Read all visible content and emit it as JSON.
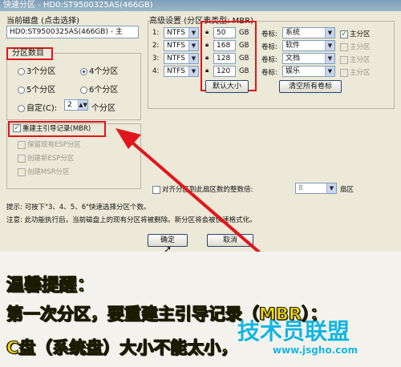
{
  "window": {
    "title": "快速分区 - HD0:ST9500325AS(466GB)"
  },
  "disk": {
    "label": "当前磁盘 (点击选择)",
    "value": "HD0:ST9500325AS(466GB) - 主"
  },
  "partition_count": {
    "title": "分区数目",
    "options": [
      "3个分区",
      "4个分区",
      "5个分区",
      "6个分区"
    ],
    "selected": "4个分区",
    "custom_label": "自定(C):",
    "custom_value": "2",
    "custom_unit": "个分区"
  },
  "options": {
    "rebuild_mbr": "重建主引导记录(MBR)",
    "keep_esp": "保留现有ESP分区",
    "create_esp": "创建新ESP分区",
    "create_msr": "创建MSR分区"
  },
  "advanced": {
    "title": "高级设置 (分区表类型: MBR)",
    "rows": [
      {
        "num": "1:",
        "fs": "NTFS",
        "size": "50",
        "unit": "GB",
        "vol_label": "卷标:",
        "vol": "系统",
        "primary": "主分区",
        "primary_checked": true
      },
      {
        "num": "2:",
        "fs": "NTFS",
        "size": "168",
        "unit": "GB",
        "vol_label": "卷标:",
        "vol": "软件",
        "primary": "主分区",
        "primary_checked": false
      },
      {
        "num": "3:",
        "fs": "NTFS",
        "size": "128",
        "unit": "GB",
        "vol_label": "卷标:",
        "vol": "文档",
        "primary": "主分区",
        "primary_checked": false
      },
      {
        "num": "4:",
        "fs": "NTFS",
        "size": "120",
        "unit": "GB",
        "vol_label": "卷标:",
        "vol": "娱乐",
        "primary": "主分区",
        "primary_checked": false
      }
    ],
    "default_size_btn": "默认大小",
    "clear_labels_btn": "清空所有卷标",
    "align_label": "对齐分区到此扇区数的整数倍:",
    "align_value": "8",
    "align_unit": "扇区"
  },
  "hints": {
    "line1": "提示: 可按下\"3、4、5、6\"快速选择分区个数。",
    "line2": "注意: 此功能执行后，当前磁盘上的现有分区将被删除。新分区将会被快速格式化。"
  },
  "buttons": {
    "ok": "确定",
    "cancel": "取消"
  },
  "tips": {
    "heading": "温馨提醒：",
    "line1": "第一次分区，要重建主引导记录（MBR）；",
    "line2": "C盘（系统盘）大小不能太小，"
  },
  "watermark": {
    "logo": "技术员联盟",
    "url": "www.jsgho.com"
  },
  "colors": {
    "highlight": "#e0161c",
    "tip_text": "#f5d700",
    "watermark": "#13b5e0"
  }
}
